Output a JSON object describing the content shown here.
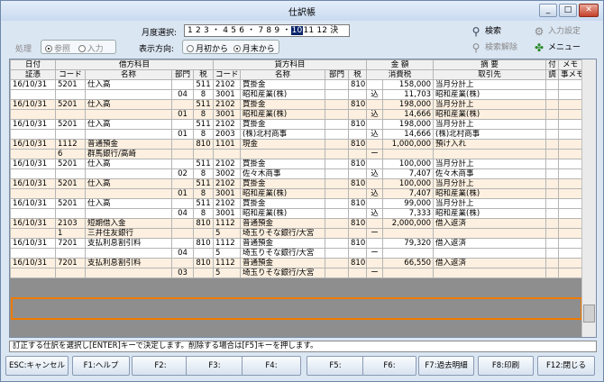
{
  "window": {
    "title": "仕訳帳",
    "min": "_",
    "max": "□",
    "close": "✕"
  },
  "toolbar": {
    "month_label": "月度選択:",
    "month_text_before": "1 2 3 ・ 4 5 6 ・ 7 8 9 ・",
    "month_selected": "10",
    "month_text_after": "11 12 決",
    "process_label": "処理",
    "opt_view": "参照",
    "opt_input": "入力",
    "direction_label": "表示方向:",
    "opt_from_start": "月初から",
    "opt_from_end": "月末から",
    "search": "検索",
    "search_clear": "検索解除",
    "input_settings": "入力設定",
    "menu": "メニュー"
  },
  "table": {
    "h1": {
      "date": "日付",
      "debit": "借方科目",
      "credit": "貸方科目",
      "amount": "金 額",
      "summary": "摘 要",
      "attach": "付",
      "memo": "メモ"
    },
    "h2": {
      "voucher": "証憑",
      "code": "コード",
      "name": "名称",
      "dept": "部門",
      "tax": "税",
      "code2": "コード",
      "name2": "名称",
      "dept2": "部門",
      "tax2": "税",
      "tax_amount": "消費税",
      "partner": "取引先",
      "adj": "調",
      "item": "事メモ"
    },
    "rows": [
      {
        "a": [
          "16/10/31",
          "5201",
          "仕入高",
          "",
          "511",
          "2102",
          "買掛金",
          "",
          "810",
          "",
          "158,000",
          "当月分計上"
        ],
        "b": [
          "",
          "",
          "",
          "04",
          "8",
          "3001",
          "昭和産業(株)",
          "",
          "",
          "込",
          "11,703",
          "昭和産業(株)"
        ]
      },
      {
        "a": [
          "16/10/31",
          "5201",
          "仕入高",
          "",
          "511",
          "2102",
          "買掛金",
          "",
          "810",
          "",
          "198,000",
          "当月分計上"
        ],
        "b": [
          "",
          "",
          "",
          "01",
          "8",
          "3001",
          "昭和産業(株)",
          "",
          "",
          "込",
          "14,666",
          "昭和産業(株)"
        ]
      },
      {
        "a": [
          "16/10/31",
          "5201",
          "仕入高",
          "",
          "511",
          "2102",
          "買掛金",
          "",
          "810",
          "",
          "198,000",
          "当月分計上"
        ],
        "b": [
          "",
          "",
          "",
          "01",
          "8",
          "2003",
          "(株)北村商事",
          "",
          "",
          "込",
          "14,666",
          "(株)北村商事"
        ]
      },
      {
        "a": [
          "16/10/31",
          "1112",
          "普通預金",
          "",
          "810",
          "1101",
          "現金",
          "",
          "810",
          "",
          "1,000,000",
          "預け入れ"
        ],
        "b": [
          "",
          "6",
          "群馬銀行/高崎",
          "",
          "",
          "",
          "",
          "",
          "",
          "ー",
          "",
          ""
        ]
      },
      {
        "a": [
          "16/10/31",
          "5201",
          "仕入高",
          "",
          "511",
          "2102",
          "買掛金",
          "",
          "810",
          "",
          "100,000",
          "当月分計上"
        ],
        "b": [
          "",
          "",
          "",
          "02",
          "8",
          "3002",
          "佐々木商事",
          "",
          "",
          "込",
          "7,407",
          "佐々木商事"
        ]
      },
      {
        "a": [
          "16/10/31",
          "5201",
          "仕入高",
          "",
          "511",
          "2102",
          "買掛金",
          "",
          "810",
          "",
          "100,000",
          "当月分計上"
        ],
        "b": [
          "",
          "",
          "",
          "01",
          "8",
          "3001",
          "昭和産業(株)",
          "",
          "",
          "込",
          "7,407",
          "昭和産業(株)"
        ]
      },
      {
        "a": [
          "16/10/31",
          "5201",
          "仕入高",
          "",
          "511",
          "2102",
          "買掛金",
          "",
          "810",
          "",
          "99,000",
          "当月分計上"
        ],
        "b": [
          "",
          "",
          "",
          "04",
          "8",
          "3001",
          "昭和産業(株)",
          "",
          "",
          "込",
          "7,333",
          "昭和産業(株)"
        ]
      },
      {
        "a": [
          "16/10/31",
          "2103",
          "短期借入金",
          "",
          "810",
          "1112",
          "普通預金",
          "",
          "810",
          "",
          "2,000,000",
          "借入返済"
        ],
        "b": [
          "",
          "1",
          "三井住友銀行",
          "",
          "",
          "5",
          "埼玉りそな銀行/大宮",
          "",
          "",
          "ー",
          "",
          ""
        ]
      },
      {
        "a": [
          "16/10/31",
          "7201",
          "支払利息割引料",
          "",
          "810",
          "1112",
          "普通預金",
          "",
          "810",
          "",
          "79,320",
          "借入返済"
        ],
        "b": [
          "",
          "",
          "",
          "04",
          "",
          "5",
          "埼玉りそな銀行/大宮",
          "",
          "",
          "ー",
          "",
          ""
        ]
      },
      {
        "a": [
          "16/10/31",
          "7201",
          "支払利息割引料",
          "",
          "810",
          "1112",
          "普通預金",
          "",
          "810",
          "",
          "66,550",
          "借入返済"
        ],
        "b": [
          "",
          "",
          "",
          "03",
          "",
          "5",
          "埼玉りそな銀行/大宮",
          "",
          "",
          "ー",
          "",
          ""
        ]
      }
    ]
  },
  "status_text": "訂正する仕訳を選択し[ENTER]キーで決定します。削除する場合は[F5]キーを押します。",
  "fkeys": [
    "ESC:キャンセル",
    "F1:ヘルプ",
    "F2:",
    "F3:",
    "F4:",
    "F5:",
    "F6:",
    "F7:過去明細",
    "F8:印刷",
    "F12:閉じる"
  ]
}
